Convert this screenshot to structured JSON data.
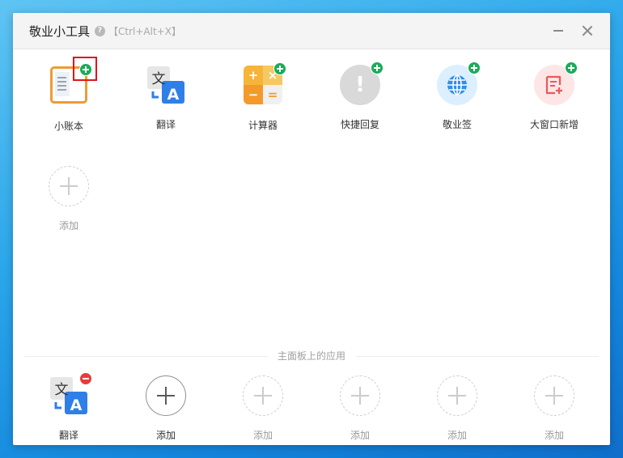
{
  "window": {
    "title": "敬业小工具",
    "shortcut": "【Ctrl+Alt+X】"
  },
  "tools": [
    {
      "label": "小账本",
      "icon": "ledger-icon"
    },
    {
      "label": "翻译",
      "icon": "translate-icon"
    },
    {
      "label": "计算器",
      "icon": "calculator-icon"
    },
    {
      "label": "快捷回复",
      "icon": "quick-reply-icon"
    },
    {
      "label": "敬业签",
      "icon": "globe-icon"
    },
    {
      "label": "大窗口新增",
      "icon": "sticky-note-add-icon"
    }
  ],
  "add_tile": {
    "label": "添加"
  },
  "panel": {
    "divider_label": "主面板上的应用",
    "items": [
      {
        "label": "翻译"
      },
      {
        "label": "添加"
      },
      {
        "label": "添加"
      },
      {
        "label": "添加"
      },
      {
        "label": "添加"
      },
      {
        "label": "添加"
      }
    ]
  },
  "icons": {
    "translate_glyph_cn": "文",
    "translate_glyph_en": "A",
    "quick_reply_glyph": "!",
    "calc_glyphs": [
      "+",
      "×",
      "−",
      "="
    ]
  },
  "colors": {
    "add_badge": "#1bab5a",
    "remove_badge": "#e63c3c",
    "highlight": "#e0151b",
    "ledger": "#ef9a35",
    "calculator": "#f6b43a",
    "globe": "#2f8ee8"
  }
}
